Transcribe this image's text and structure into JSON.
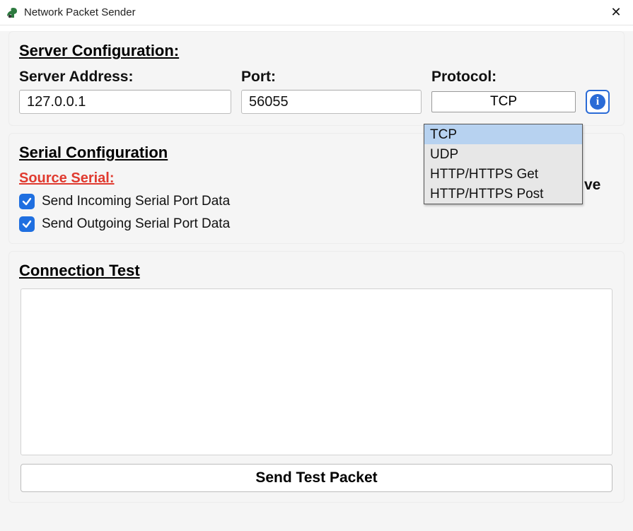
{
  "window": {
    "title": "Network Packet Sender"
  },
  "server": {
    "heading": "Server Configuration:",
    "address_label": "Server Address:",
    "address_value": "127.0.0.1",
    "port_label": "Port:",
    "port_value": "56055",
    "protocol_label": "Protocol:",
    "protocol_selected": "TCP",
    "protocol_options": [
      "TCP",
      "UDP",
      "HTTP/HTTPS Get",
      "HTTP/HTTPS Post"
    ]
  },
  "serial": {
    "heading": "Serial Configuration",
    "source_label": "Source Serial:",
    "chk_incoming_label": "Send Incoming Serial Port Data",
    "chk_incoming_checked": true,
    "chk_outgoing_label": "Send Outgoing Serial Port Data",
    "chk_outgoing_checked": true,
    "obscured_text_tail": "ve"
  },
  "test": {
    "heading": "Connection Test",
    "send_button": "Send Test Packet"
  },
  "icons": {
    "info_glyph": "i",
    "close_glyph": "✕"
  }
}
